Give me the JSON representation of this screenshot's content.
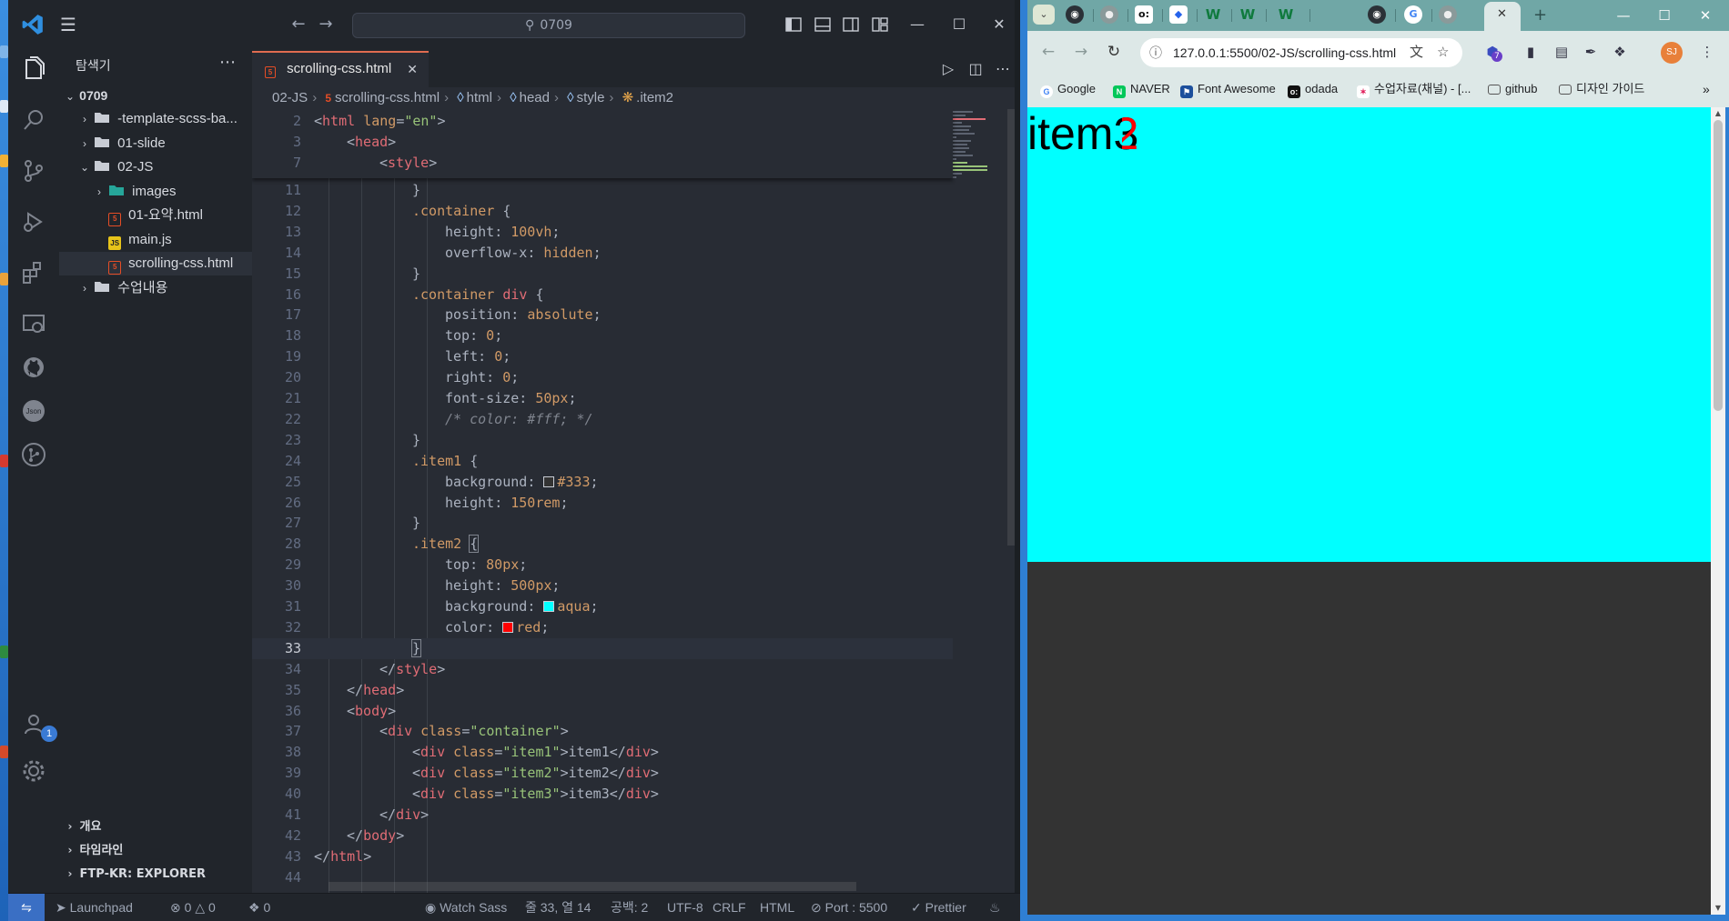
{
  "vscode": {
    "search_text": "0709",
    "sidebar_title": "탐색기",
    "root_folder": "0709",
    "tree": [
      {
        "label": "-template-scss-ba...",
        "type": "folder"
      },
      {
        "label": "01-slide",
        "type": "folder"
      },
      {
        "label": "02-JS",
        "type": "folder-open"
      },
      {
        "label": "images",
        "type": "folder-images"
      },
      {
        "label": "01-요약.html",
        "type": "html"
      },
      {
        "label": "main.js",
        "type": "js"
      },
      {
        "label": "scrolling-css.html",
        "type": "html"
      },
      {
        "label": "수업내용",
        "type": "folder"
      }
    ],
    "panels": [
      "개요",
      "타임라인",
      "FTP-KR: EXPLORER"
    ],
    "accounts_badge": "1",
    "active_tab": "scrolling-css.html",
    "breadcrumb": [
      "02-JS",
      "scrolling-css.html",
      "html",
      "head",
      "style",
      ".item2"
    ],
    "sticky": [
      {
        "n": "2",
        "indent": 0,
        "html": "<span class='t-punc'>&lt;</span><span class='t-tag'>html</span> <span class='t-attr'>lang</span><span class='t-punc'>=</span><span class='t-str'>\"en\"</span><span class='t-punc'>&gt;</span>"
      },
      {
        "n": "3",
        "indent": 1,
        "html": "<span class='t-punc'>&lt;</span><span class='t-tag'>head</span><span class='t-punc'>&gt;</span>"
      },
      {
        "n": "7",
        "indent": 2,
        "html": "<span class='t-punc'>&lt;</span><span class='t-tag'>style</span><span class='t-punc'>&gt;</span>"
      }
    ],
    "lines": [
      {
        "n": "11",
        "indent": 3,
        "html": "<span class='t-punc'>}</span>"
      },
      {
        "n": "12",
        "indent": 3,
        "html": "<span class='t-sel'>.container</span> <span class='t-punc'>{</span>"
      },
      {
        "n": "13",
        "indent": 4,
        "html": "<span class='t-prop'>height</span><span class='t-punc'>: </span><span class='t-num'>100vh</span><span class='t-punc'>;</span>"
      },
      {
        "n": "14",
        "indent": 4,
        "html": "<span class='t-prop'>overflow-x</span><span class='t-punc'>: </span><span class='t-kw'>hidden</span><span class='t-punc'>;</span>"
      },
      {
        "n": "15",
        "indent": 3,
        "html": "<span class='t-punc'>}</span>"
      },
      {
        "n": "16",
        "indent": 3,
        "html": "<span class='t-sel'>.container</span> <span class='t-tag'>div</span> <span class='t-punc'>{</span>"
      },
      {
        "n": "17",
        "indent": 4,
        "html": "<span class='t-prop'>position</span><span class='t-punc'>: </span><span class='t-kw'>absolute</span><span class='t-punc'>;</span>"
      },
      {
        "n": "18",
        "indent": 4,
        "html": "<span class='t-prop'>top</span><span class='t-punc'>: </span><span class='t-num'>0</span><span class='t-punc'>;</span>"
      },
      {
        "n": "19",
        "indent": 4,
        "html": "<span class='t-prop'>left</span><span class='t-punc'>: </span><span class='t-num'>0</span><span class='t-punc'>;</span>"
      },
      {
        "n": "20",
        "indent": 4,
        "html": "<span class='t-prop'>right</span><span class='t-punc'>: </span><span class='t-num'>0</span><span class='t-punc'>;</span>"
      },
      {
        "n": "21",
        "indent": 4,
        "html": "<span class='t-prop'>font-size</span><span class='t-punc'>: </span><span class='t-num'>50px</span><span class='t-punc'>;</span>"
      },
      {
        "n": "22",
        "indent": 4,
        "html": "<span class='t-com'>/* color: #fff; */</span>"
      },
      {
        "n": "23",
        "indent": 3,
        "html": "<span class='t-punc'>}</span>"
      },
      {
        "n": "24",
        "indent": 3,
        "html": "<span class='t-sel'>.item1</span> <span class='t-punc'>{</span>"
      },
      {
        "n": "25",
        "indent": 4,
        "html": "<span class='t-prop'>background</span><span class='t-punc'>: </span><span class='swatch' style='background:#333'></span><span class='t-num'>#333</span><span class='t-punc'>;</span>"
      },
      {
        "n": "26",
        "indent": 4,
        "html": "<span class='t-prop'>height</span><span class='t-punc'>: </span><span class='t-num'>150rem</span><span class='t-punc'>;</span>"
      },
      {
        "n": "27",
        "indent": 3,
        "html": "<span class='t-punc'>}</span>"
      },
      {
        "n": "28",
        "indent": 3,
        "html": "<span class='t-sel'>.item2</span> <span class='t-punc brace-hl'>{</span>"
      },
      {
        "n": "29",
        "indent": 4,
        "html": "<span class='t-prop'>top</span><span class='t-punc'>: </span><span class='t-num'>80px</span><span class='t-punc'>;</span>"
      },
      {
        "n": "30",
        "indent": 4,
        "html": "<span class='t-prop'>height</span><span class='t-punc'>: </span><span class='t-num'>500px</span><span class='t-punc'>;</span>"
      },
      {
        "n": "31",
        "indent": 4,
        "html": "<span class='t-prop'>background</span><span class='t-punc'>: </span><span class='swatch' style='background:aqua'></span><span class='t-kw'>aqua</span><span class='t-punc'>;</span>"
      },
      {
        "n": "32",
        "indent": 4,
        "html": "<span class='t-prop'>color</span><span class='t-punc'>: </span><span class='swatch' style='background:red'></span><span class='t-kw'>red</span><span class='t-punc'>;</span>"
      },
      {
        "n": "33",
        "indent": 3,
        "html": "<span class='t-punc brace-hl'>}</span>",
        "current": true
      },
      {
        "n": "34",
        "indent": 2,
        "html": "<span class='t-punc'>&lt;/</span><span class='t-tag'>style</span><span class='t-punc'>&gt;</span>"
      },
      {
        "n": "35",
        "indent": 1,
        "html": "<span class='t-punc'>&lt;/</span><span class='t-tag'>head</span><span class='t-punc'>&gt;</span>"
      },
      {
        "n": "36",
        "indent": 1,
        "html": "<span class='t-punc'>&lt;</span><span class='t-tag'>body</span><span class='t-punc'>&gt;</span>"
      },
      {
        "n": "37",
        "indent": 2,
        "html": "<span class='t-punc'>&lt;</span><span class='t-tag'>div</span> <span class='t-attr'>class</span><span class='t-punc'>=</span><span class='t-str'>\"container\"</span><span class='t-punc'>&gt;</span>"
      },
      {
        "n": "38",
        "indent": 3,
        "html": "<span class='t-punc'>&lt;</span><span class='t-tag'>div</span> <span class='t-attr'>class</span><span class='t-punc'>=</span><span class='t-str'>\"item1\"</span><span class='t-punc'>&gt;</span>item1<span class='t-punc'>&lt;/</span><span class='t-tag'>div</span><span class='t-punc'>&gt;</span>"
      },
      {
        "n": "39",
        "indent": 3,
        "html": "<span class='t-punc'>&lt;</span><span class='t-tag'>div</span> <span class='t-attr'>class</span><span class='t-punc'>=</span><span class='t-str'>\"item2\"</span><span class='t-punc'>&gt;</span>item2<span class='t-punc'>&lt;/</span><span class='t-tag'>div</span><span class='t-punc'>&gt;</span>"
      },
      {
        "n": "40",
        "indent": 3,
        "html": "<span class='t-punc'>&lt;</span><span class='t-tag'>div</span> <span class='t-attr'>class</span><span class='t-punc'>=</span><span class='t-str'>\"item3\"</span><span class='t-punc'>&gt;</span>item3<span class='t-punc'>&lt;/</span><span class='t-tag'>div</span><span class='t-punc'>&gt;</span>"
      },
      {
        "n": "41",
        "indent": 2,
        "html": "<span class='t-punc'>&lt;/</span><span class='t-tag'>div</span><span class='t-punc'>&gt;</span>"
      },
      {
        "n": "42",
        "indent": 1,
        "html": "<span class='t-punc'>&lt;/</span><span class='t-tag'>body</span><span class='t-punc'>&gt;</span>"
      },
      {
        "n": "43",
        "indent": 0,
        "html": "<span class='t-punc'>&lt;/</span><span class='t-tag'>html</span><span class='t-punc'>&gt;</span>"
      },
      {
        "n": "44",
        "indent": 0,
        "html": ""
      }
    ],
    "status": {
      "launchpad": "Launchpad",
      "errors": "0",
      "warnings": "0",
      "ports": "0",
      "watch_sass": "Watch Sass",
      "position": "줄 33, 열 14",
      "spaces": "공백: 2",
      "encoding": "UTF-8",
      "eol": "CRLF",
      "language": "HTML",
      "port": "Port : 5500",
      "prettier": "Prettier"
    }
  },
  "browser": {
    "url": "127.0.0.1:5500/02-JS/scrolling-css.html",
    "bookmarks": [
      "Google",
      "NAVER",
      "Font Awesome",
      "odada",
      "수업자료(채널) - [...",
      "github",
      "디자인 가이드"
    ],
    "ext_badge": "7",
    "avatar_initials": "SJ",
    "page": {
      "item3_text": "item3",
      "item2_text": "item2",
      "item2_bg": "#00ffff",
      "item1_bg": "#333333",
      "item2_color": "#ff0000"
    }
  }
}
